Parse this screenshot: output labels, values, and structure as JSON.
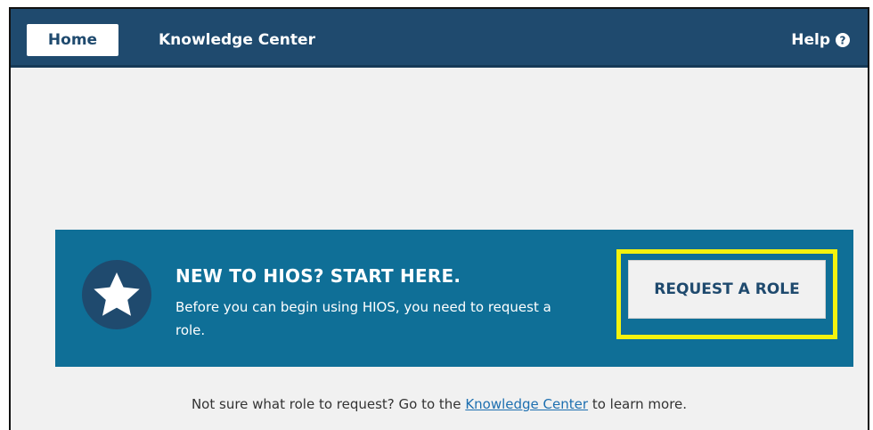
{
  "nav": {
    "home_label": "Home",
    "knowledge_center_label": "Knowledge Center",
    "help_label": "Help",
    "help_icon": "question-circle-icon"
  },
  "banner": {
    "icon": "star-icon",
    "title": "NEW TO HIOS? START HERE.",
    "text": "Before you can begin using HIOS, you need to request a role.",
    "button_label": "REQUEST A ROLE",
    "highlight_color": "#f4f20e"
  },
  "footer": {
    "prefix": "Not sure what role to request? Go to the",
    "link_label": "Knowledge Center",
    "suffix": "to learn more."
  },
  "colors": {
    "navbar": "#1f4a6e",
    "banner": "#0f6f97",
    "page_background": "#f1f1f1"
  }
}
